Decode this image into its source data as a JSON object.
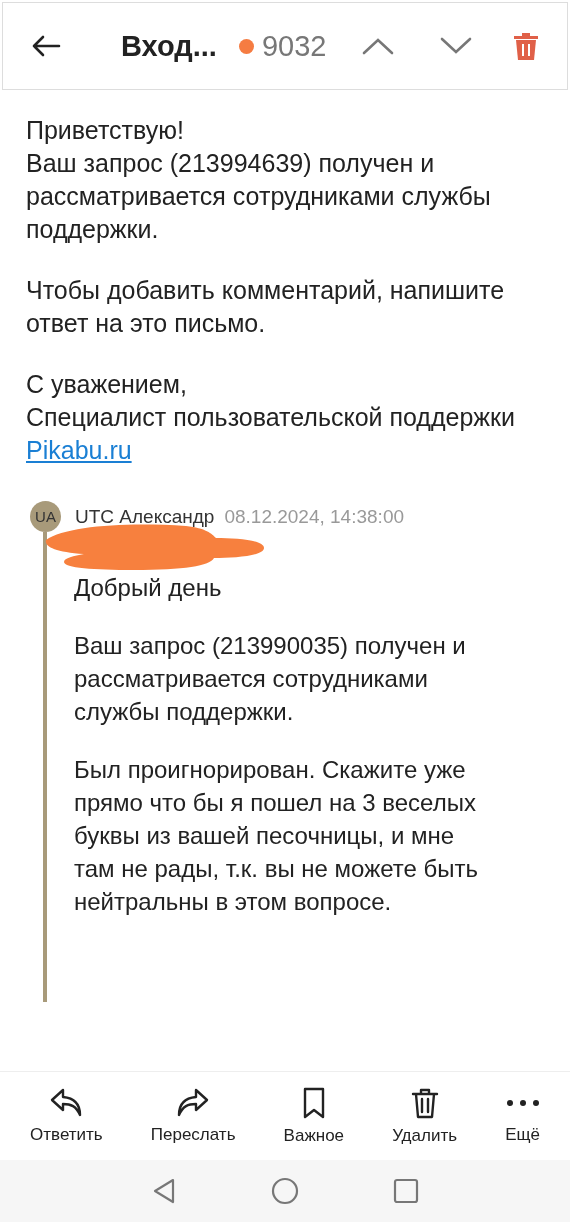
{
  "header": {
    "folder": "Вход...",
    "unread_count": "9032"
  },
  "message": {
    "paragraphs": [
      "Приветствую!\nВаш запрос (213994639) получен и\nрассматривается сотрудниками службы\nподдержки.",
      "Чтобы добавить комментарий, напишите\nответ на это письмо.",
      "С уважением,\nСпециалист пользовательской поддержки"
    ],
    "link": "Pikabu.ru"
  },
  "quote": {
    "avatar": "UA",
    "sender": "UTC Александр",
    "date": "08.12.2024, 14:38:00",
    "redacted": true,
    "paragraphs": [
      "Добрый день",
      "Ваш запрос (213990035) получен и\nрассматривается сотрудниками\nслужбы поддержки.",
      "Был проигнорирован. Скажите уже\nпрямо что бы я пошел на 3 веселых\nбуквы из вашей песочницы, и мне\nтам не рады, т.к. вы не можете быть\nнейтральны в этом вопросе."
    ]
  },
  "actions": [
    {
      "kind": "reply",
      "label": "Ответить"
    },
    {
      "kind": "forward",
      "label": "Переслать"
    },
    {
      "kind": "bookmark",
      "label": "Важное"
    },
    {
      "kind": "delete",
      "label": "Удалить"
    },
    {
      "kind": "more",
      "label": "Ещё"
    }
  ]
}
